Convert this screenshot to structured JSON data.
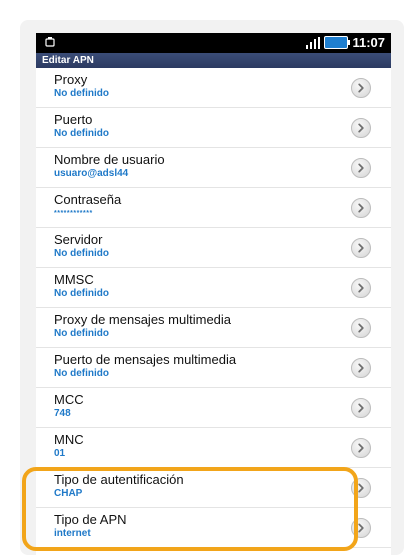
{
  "status": {
    "time": "11:07"
  },
  "title": "Editar APN",
  "rows": [
    {
      "label": "Proxy",
      "value": "No definido"
    },
    {
      "label": "Puerto",
      "value": "No definido"
    },
    {
      "label": "Nombre de usuario",
      "value": "usuaro@adsl44"
    },
    {
      "label": "Contraseña",
      "value": "************"
    },
    {
      "label": "Servidor",
      "value": "No definido"
    },
    {
      "label": "MMSC",
      "value": "No definido"
    },
    {
      "label": "Proxy de mensajes multimedia",
      "value": "No definido"
    },
    {
      "label": "Puerto de mensajes multimedia",
      "value": "No definido"
    },
    {
      "label": "MCC",
      "value": "748"
    },
    {
      "label": "MNC",
      "value": "01"
    },
    {
      "label": "Tipo de autentificación",
      "value": "CHAP"
    },
    {
      "label": "Tipo de APN",
      "value": "internet"
    }
  ],
  "colors": {
    "value_text": "#1f79c8",
    "highlight": "#f2a51a",
    "title_bar": "#2b3a61"
  },
  "icons": {
    "status_left": "notification-icon",
    "row_action": "chevron-right-icon"
  }
}
